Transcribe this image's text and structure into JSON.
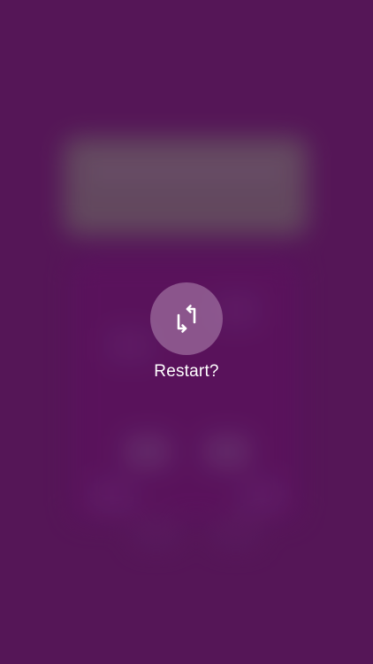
{
  "overlay": {
    "restart_label": "Restart?",
    "restart_icon": "restart-swap-icon"
  },
  "colors": {
    "background": "#58195a",
    "button_fill": "rgba(180,140,180,0.55)",
    "text": "#ffffff"
  }
}
